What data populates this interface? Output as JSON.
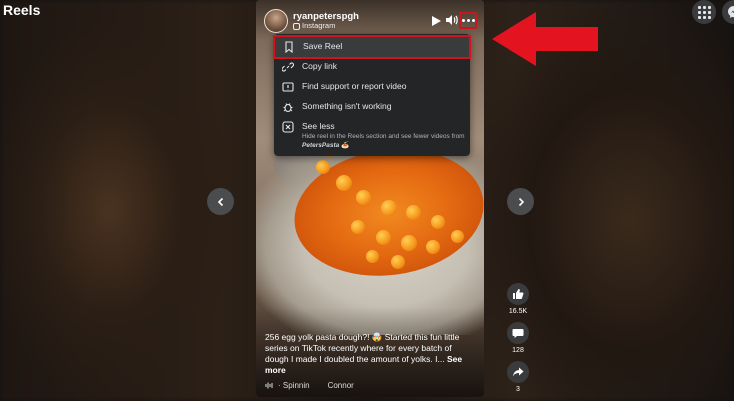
{
  "page": {
    "title": "Reels"
  },
  "reel": {
    "author": "ryanpeterspgh",
    "source": "Instagram",
    "caption": "256 egg yolk pasta dough?! 🤯 Started this fun little series on TikTok recently where for every batch of dough I made I doubled the amount of yolks. I...",
    "see_more": "See more",
    "audio_left": "· Spinnin",
    "audio_right": "Connor"
  },
  "menu": {
    "items": [
      {
        "label": "Save Reel",
        "icon": "bookmark-icon"
      },
      {
        "label": "Copy link",
        "icon": "link-icon"
      },
      {
        "label": "Find support or report video",
        "icon": "report-icon"
      },
      {
        "label": "Something isn't working",
        "icon": "bug-icon"
      },
      {
        "label": "See less",
        "icon": "close-box-icon",
        "description_line1": "Hide reel in the Reels section and see fewer videos",
        "description_from": "from",
        "description_page": "PetersPasta",
        "description_emoji": "🍝"
      }
    ]
  },
  "actions": {
    "likes": "16.5K",
    "comments": "128",
    "shares": "3"
  },
  "colors": {
    "highlight": "#d1141b",
    "menu_bg": "#242526"
  }
}
